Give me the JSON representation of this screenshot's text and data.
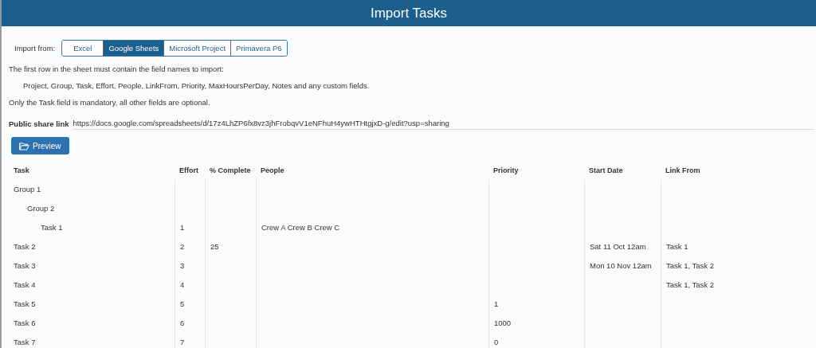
{
  "window": {
    "title": "Import Tasks"
  },
  "import_from": {
    "label": "Import from:",
    "tabs": [
      {
        "label": "Excel",
        "selected": false
      },
      {
        "label": "Google Sheets",
        "selected": true
      },
      {
        "label": "Microsoft Project",
        "selected": false
      },
      {
        "label": "Primavera P6",
        "selected": false
      }
    ]
  },
  "instructions": {
    "intro": "The first row in the sheet must contain the field names to import:",
    "fields": "Project, Group, Task, Effort, People, LinkFrom, Priority, MaxHoursPerDay, Notes and any custom fields.",
    "note": "Only the Task field is mandatory, all other fields are optional."
  },
  "share_link": {
    "label": "Public share link",
    "value": "https://docs.google.com/spreadsheets/d/17z4LhZP6fx8vz3jhFrobqvV1eNFhuH4ywHTHtgjxD-g/edit?usp=sharing"
  },
  "preview_button": "Preview",
  "table": {
    "columns": [
      "Task",
      "Effort",
      "% Complete",
      "People",
      "Priority",
      "Start Date",
      "Link From"
    ],
    "rows": [
      {
        "cells": [
          "Group 1",
          "",
          "",
          "",
          "",
          "",
          ""
        ],
        "children": [
          {
            "cells": [
              "Group 2",
              "",
              "",
              "",
              "",
              "",
              ""
            ],
            "children": [
              {
                "cells": [
                  "Task 1",
                  "1",
                  "",
                  "Crew A Crew B Crew C",
                  "",
                  "",
                  ""
                ]
              }
            ]
          }
        ]
      },
      {
        "cells": [
          "Task 2",
          "2",
          "25",
          "",
          "",
          "Sat 11 Oct 12am",
          "Task 1"
        ]
      },
      {
        "cells": [
          "Task 3",
          "3",
          "",
          "",
          "",
          "Mon 10 Nov 12am",
          "Task 1, Task 2"
        ]
      },
      {
        "cells": [
          "Task 4",
          "4",
          "",
          "",
          "",
          "",
          "Task 1, Task 2"
        ]
      },
      {
        "cells": [
          "Task 5",
          "5",
          "",
          "",
          "1",
          "",
          ""
        ]
      },
      {
        "cells": [
          "Task 6",
          "6",
          "",
          "",
          "1000",
          "",
          ""
        ]
      },
      {
        "cells": [
          "Task 7",
          "7",
          "",
          "",
          "0",
          "",
          ""
        ]
      }
    ]
  }
}
